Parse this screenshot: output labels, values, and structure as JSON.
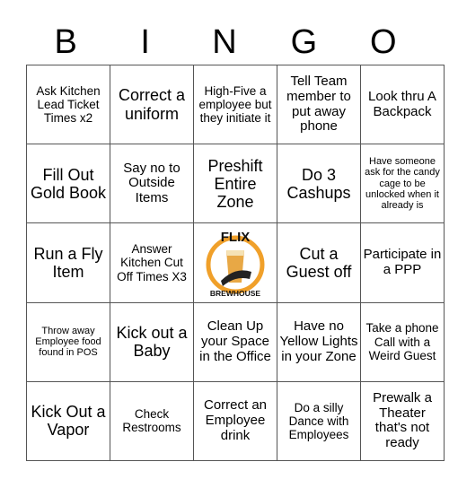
{
  "header": {
    "letters": [
      "B",
      "I",
      "N",
      "G",
      "O"
    ]
  },
  "board": {
    "rows": [
      [
        "Ask Kitchen Lead Ticket Times x2",
        "Correct a uniform",
        "High-Five a employee but they initiate it",
        "Tell Team member to put away phone",
        "Look thru A Backpack"
      ],
      [
        "Fill Out Gold Book",
        "Say no to Outside Items",
        "Preshift Entire Zone",
        "Do 3 Cashups",
        "Have someone ask for the candy cage to be unlocked when it already is"
      ],
      [
        "Run a Fly Item",
        "Answer Kitchen Cut Off Times X3",
        "",
        "Cut a Guest off",
        "Participate in a PPP"
      ],
      [
        "Throw away Employee food found in POS",
        "Kick out a Baby",
        "Clean Up your Space in the Office",
        "Have no Yellow Lights in your Zone",
        "Take a phone Call with a Weird Guest"
      ],
      [
        "Kick Out a Vapor",
        "Check Restrooms",
        "Correct an Employee drink",
        "Do a silly Dance with Employees",
        "Prewalk a Theater that's not ready"
      ]
    ],
    "free_space": {
      "logo_top_text": "FLIX",
      "logo_bottom_text": "BREWHOUSE",
      "accent_color": "#f0a02a"
    }
  }
}
